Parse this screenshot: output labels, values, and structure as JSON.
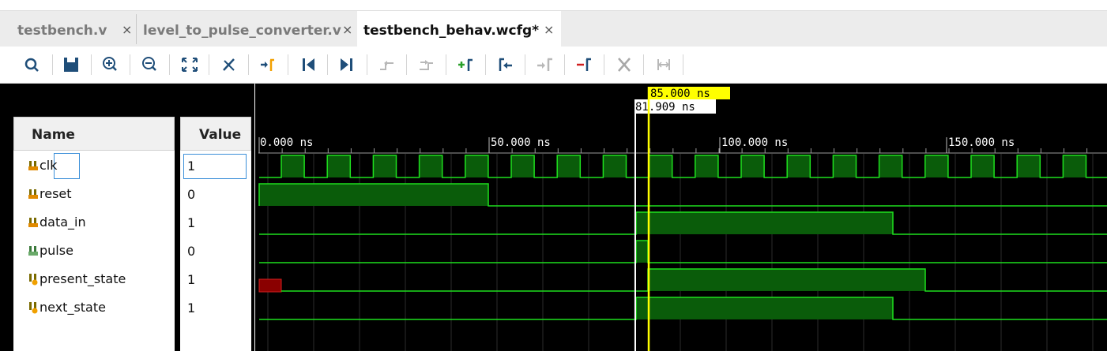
{
  "tabs": [
    {
      "label": "testbench.v",
      "close": "×",
      "active": false
    },
    {
      "label": "level_to_pulse_converter.v",
      "close": "×",
      "active": false
    },
    {
      "label": "testbench_behav.wcfg*",
      "close": "×",
      "active": true
    }
  ],
  "toolbar": {
    "icons": [
      "search-icon",
      "save-icon",
      "zoom-in-icon",
      "zoom-out-icon",
      "zoom-fit-icon",
      "snap-icon",
      "go-to-cursor-icon",
      "go-to-time-zero-icon",
      "go-to-last-time-icon",
      "previous-transition-icon",
      "next-transition-icon",
      "add-marker-icon",
      "previous-marker-icon",
      "next-marker-icon",
      "delete-marker-icon",
      "delete-all-markers-icon",
      "swap-cursors-icon"
    ]
  },
  "columns": {
    "name": "Name",
    "value": "Value"
  },
  "signals": [
    {
      "name": "clk",
      "value": "1",
      "icon": "bit-signal-icon",
      "selected": true
    },
    {
      "name": "reset",
      "value": "0",
      "icon": "bit-signal-icon"
    },
    {
      "name": "data_in",
      "value": "1",
      "icon": "bit-signal-icon"
    },
    {
      "name": "pulse",
      "value": "0",
      "icon": "output-signal-icon"
    },
    {
      "name": "present_state",
      "value": "1",
      "icon": "internal-signal-icon"
    },
    {
      "name": "next_state",
      "value": "1",
      "icon": "internal-signal-icon"
    }
  ],
  "timeline": {
    "cursor_label": "85.000 ns",
    "marker_label": "81.909 ns",
    "ticks": [
      "0.000 ns",
      "50.000 ns",
      "100.000 ns",
      "150.000 ns"
    ]
  },
  "colors": {
    "wave_green": "#1ee01e",
    "fill_green": "#0a5c0a",
    "cursor_yellow": "#ffff00",
    "fill_red": "#8a0000"
  }
}
